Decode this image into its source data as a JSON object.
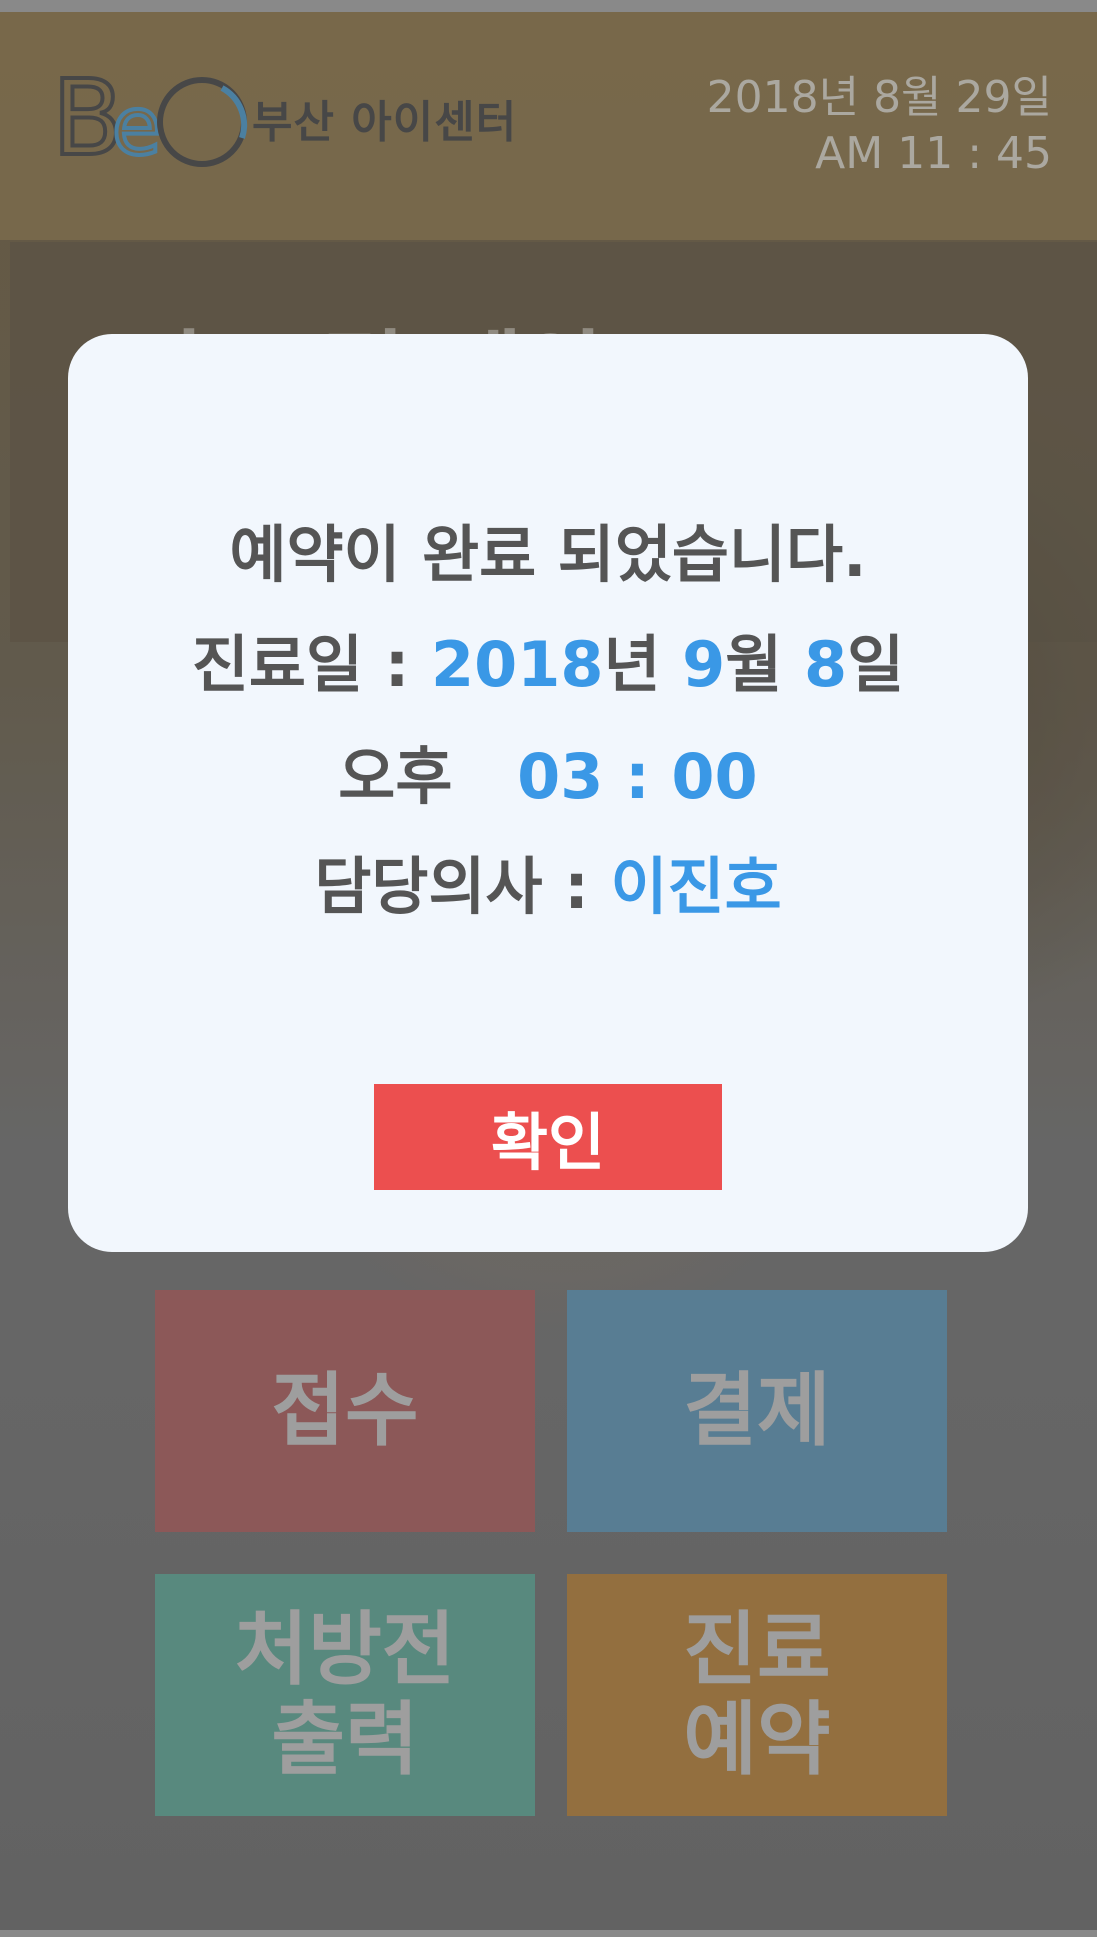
{
  "header": {
    "logo_text": "BeC",
    "center_name": "부산 아이센터",
    "date": "2018년 8월 29일",
    "time": "AM 11 : 45"
  },
  "banner": {
    "title": "진료 및 예약"
  },
  "menu": {
    "reception": [
      "접수"
    ],
    "payment": [
      "결제"
    ],
    "prescription": [
      "처방전",
      "출력"
    ],
    "appointment": [
      "진료",
      "예약"
    ]
  },
  "dialog": {
    "message": "예약이 완료 되었습니다.",
    "date_label": "진료일 :",
    "date_year": "2018",
    "date_year_unit": "년",
    "date_month": "9",
    "date_month_unit": "월",
    "date_day": "8",
    "date_day_unit": "일",
    "time_period": "오후",
    "time_value": "03 : 00",
    "doctor_label": "담당의사 :",
    "doctor_name": "이진호",
    "confirm_label": "확인"
  },
  "colors": {
    "accent_blue": "#3a98e6",
    "confirm_red": "#ec4f4f",
    "tile_reception": "#9e5f5f",
    "tile_payment": "#5f8ca7",
    "tile_prescription": "#5f9a8d",
    "tile_appointment": "#a67b40"
  }
}
